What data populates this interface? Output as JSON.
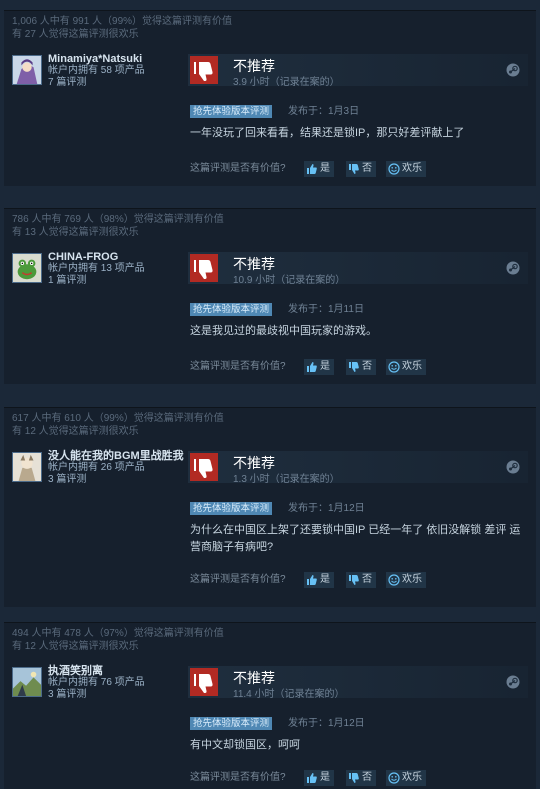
{
  "common": {
    "verdict": "不推荐",
    "early_access": "抢先体验版本评测",
    "helpful_question": "这篇评测是否有价值?",
    "yes": "是",
    "no": "否",
    "funny": "欢乐"
  },
  "reviews": [
    {
      "stat_helpful": "1,006 人中有 991 人（99%）觉得这篇评测有价值",
      "stat_funny": "有 27 人觉得这篇评测很欢乐",
      "username": "Minamiya*Natsuki",
      "products": "帐户内拥有 58 项产品",
      "review_count": "7 篇评测",
      "hours": "3.9 小时（记录在案的）",
      "posted": "发布于：1月3日",
      "text": "一年没玩了回来看看，结果还是锁IP，那只好差评献上了"
    },
    {
      "stat_helpful": "786 人中有 769 人（98%）觉得这篇评测有价值",
      "stat_funny": "有 13 人觉得这篇评测很欢乐",
      "username": "CHINA-FROG",
      "products": "帐户内拥有 13 项产品",
      "review_count": "1 篇评测",
      "hours": "10.9 小时（记录在案的）",
      "posted": "发布于：1月11日",
      "text": "这是我见过的最歧视中国玩家的游戏。"
    },
    {
      "stat_helpful": "617 人中有 610 人（99%）觉得这篇评测有价值",
      "stat_funny": "有 12 人觉得这篇评测很欢乐",
      "username": "没人能在我的BGM里战胜我",
      "products": "帐户内拥有 26 项产品",
      "review_count": "3 篇评测",
      "hours": "1.3 小时（记录在案的）",
      "posted": "发布于：1月12日",
      "text": "为什么在中国区上架了还要锁中国IP 已经一年了 依旧没解锁 差评 运营商脑子有病吧?"
    },
    {
      "stat_helpful": "494 人中有 478 人（97%）觉得这篇评测有价值",
      "stat_funny": "有 12 人觉得这篇评测很欢乐",
      "username": "执酒笑别离",
      "products": "帐户内拥有 76 项产品",
      "review_count": "3 篇评测",
      "hours": "11.4 小时（记录在案的）",
      "posted": "发布于：1月12日",
      "text": "有中文却锁国区，呵呵"
    }
  ],
  "colors": {
    "background": "#1b2838",
    "panel": "#16202d",
    "thumb_down": "#b22a23",
    "badge": "#4f88b4",
    "link": "#67c1f5"
  }
}
